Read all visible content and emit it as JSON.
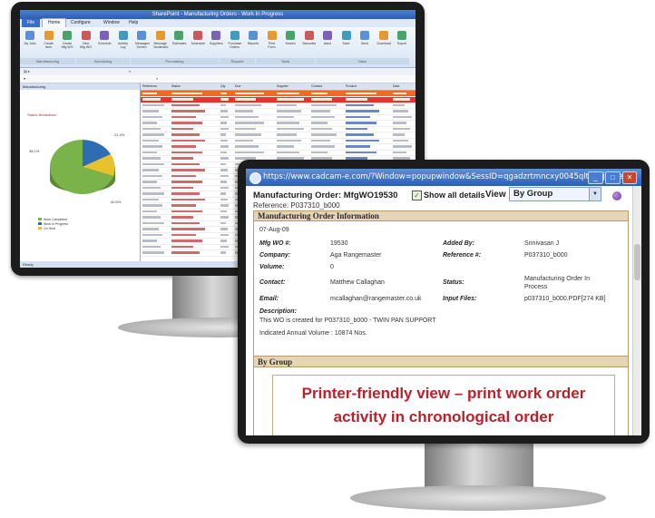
{
  "back_window": {
    "title": "SharePoint - Manufacturing Orders - Work In Progress",
    "menu": [
      "File",
      "Home",
      "Configure",
      "Window",
      "Help"
    ],
    "ribbon_buttons": [
      "My Jobs",
      "Create Item",
      "Create Mfg WO",
      "View Mfg WO",
      "Schedule",
      "Activity Log",
      "Messages Screen",
      "Message Bookmark",
      "Estimates",
      "Scheduler",
      "Suppliers",
      "Purchase Orders",
      "Reports",
      "Print Form",
      "Search",
      "Barcodes",
      "Issue",
      "Save",
      "Send",
      "Download",
      "Export"
    ],
    "ribbon_groups": [
      "Manufacturing",
      "Scheduling",
      "Purchasing",
      "Reports",
      "Tools",
      "Data"
    ],
    "left_pane_title": "Manufacturing",
    "chart_title": "Status Breakdown",
    "pie_labels": [
      "21.4%",
      "38.1%",
      "40.5%"
    ],
    "legend": [
      "Work Completed",
      "Work In Progress",
      "On Hold"
    ],
    "grid_headers": [
      "Reference",
      "Status",
      "Qty",
      "Due",
      "Supplier",
      "Contact",
      "Product",
      "Date"
    ],
    "status_text": "Ready"
  },
  "front_window": {
    "url": "https://www.cadcam-e.com/?Window=popupwindow&SessID=qgadzrtmncxy0045qltbc3jlllolel...",
    "title": "Manufacturing Order: MfgWO19530",
    "reference": "Reference: P037310_b000",
    "show_all_details": "Show all details",
    "view_label": "View",
    "view_value": "By Group",
    "section_title": "Manufacturing Order Information",
    "date": "07-Aug-09",
    "fields": {
      "mfg_wo_label": "Mfg WO #:",
      "mfg_wo": "19530",
      "added_by_label": "Added By:",
      "added_by": "Srinivasan J",
      "company_label": "Company:",
      "company": "Aga Rangemaster",
      "reference_label": "Reference #:",
      "reference": "P037310_b000",
      "volume_label": "Volume:",
      "volume": "0",
      "contact_label": "Contact:",
      "contact": "Matthew Callaghan",
      "status_label": "Status:",
      "status_line1": "Manufacturing Order In",
      "status_line2": "Process",
      "email_label": "Email:",
      "email": "mcallaghan@rangemaster.co.uk",
      "input_files_label": "Input Files:",
      "input_files": "p037310_b000.PDF[274 KB]",
      "description_label": "Description:",
      "description": "This WO is created for P037310_b000 - TWIN PAN SUPPORT",
      "annual_volume": "Indicated Annual Volume : 10874 Nos."
    },
    "group_title": "By Group",
    "callout_line1": "Printer-friendly view – print work order",
    "callout_line2": "activity in chronological order"
  },
  "colors": {
    "title_blue": "#2a5fb8",
    "panel_tan": "#e6d4b6",
    "callout_red": "#b8232b",
    "pie_green": "#7ab34a",
    "pie_blue": "#2f6db3",
    "pie_yellow": "#e8c12e",
    "row_highlight_orange": "#f26a21",
    "row_highlight_red": "#e8342d"
  }
}
